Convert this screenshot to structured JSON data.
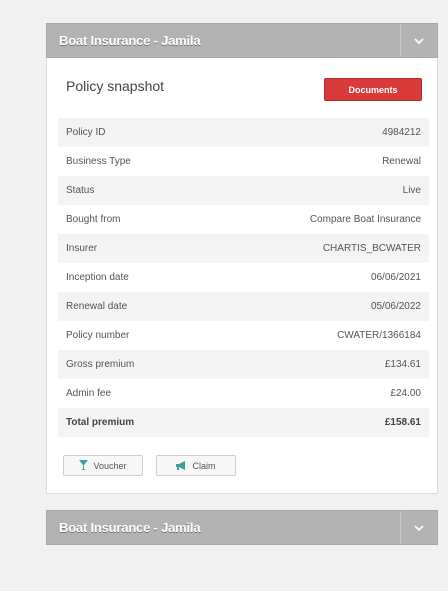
{
  "panels": [
    {
      "title_prefix": "Boat Insurance - ",
      "title_name": "Jamila"
    },
    {
      "title_prefix": "Boat Insurance - ",
      "title_name": "Jamila"
    }
  ],
  "snapshot": {
    "title": "Policy snapshot",
    "documents_label": "Documents",
    "rows": [
      {
        "label": "Policy ID",
        "value": "4984212"
      },
      {
        "label": "Business Type",
        "value": "Renewal"
      },
      {
        "label": "Status",
        "value": "Live"
      },
      {
        "label": "Bought from",
        "value": "Compare Boat Insurance"
      },
      {
        "label": "Insurer",
        "value": "CHARTIS_BCWATER"
      },
      {
        "label": "Inception date",
        "value": "06/06/2021"
      },
      {
        "label": "Renewal date",
        "value": "05/06/2022"
      },
      {
        "label": "Policy number",
        "value": "CWATER/1366184"
      },
      {
        "label": "Gross premium",
        "value": "£134.61"
      },
      {
        "label": "Admin fee",
        "value": "£24.00"
      },
      {
        "label": "Total premium",
        "value": "£158.61"
      }
    ],
    "voucher_label": "Voucher",
    "claim_label": "Claim"
  },
  "colors": {
    "header_bg": "#b3b3b3",
    "documents_button": "#d93b3b",
    "voucher_icon": "#3aa39a",
    "claim_icon": "#3aa39a"
  },
  "icons": {
    "toggle": "chevron-down-icon",
    "voucher": "cocktail-glass-icon",
    "claim": "megaphone-icon"
  }
}
